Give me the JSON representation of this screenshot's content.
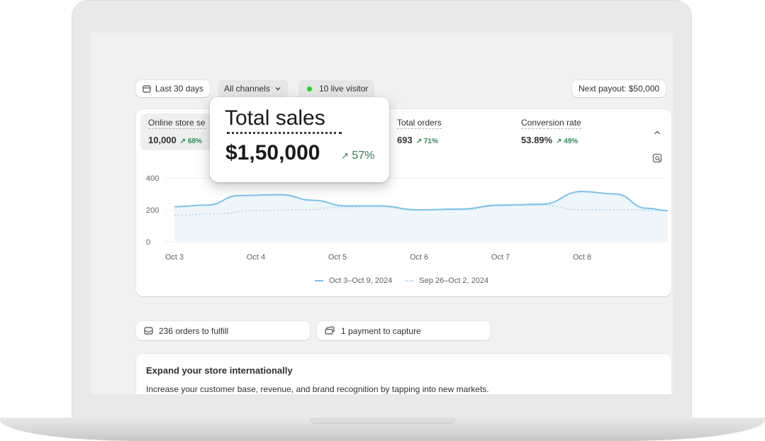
{
  "filters": {
    "date_range": "Last 30 days",
    "channels": "All channels",
    "live_visitors": "10 live visitor",
    "payout": "Next payout: $50,000"
  },
  "metrics": [
    {
      "label": "Online store se",
      "value": "10,000",
      "change": "68%"
    },
    {
      "label": "Total orders",
      "value": "693",
      "change": "71%"
    },
    {
      "label": "Conversion rate",
      "value": "53.89%",
      "change": "49%"
    }
  ],
  "tooltip": {
    "title": "Total sales",
    "value": "$1,50,000",
    "change": "57%"
  },
  "chart_data": {
    "type": "line",
    "x": [
      "Oct 3",
      "Oct 4",
      "Oct 5",
      "Oct 6",
      "Oct 7",
      "Oct 8"
    ],
    "y_ticks": [
      "400",
      "200",
      "0"
    ],
    "ylim": [
      0,
      400
    ],
    "series": [
      {
        "name": "Oct 3–Oct 9, 2024",
        "color": "#7cc0ea",
        "style": "solid",
        "points": [
          [
            0,
            220
          ],
          [
            0.4,
            230
          ],
          [
            0.8,
            290
          ],
          [
            1.3,
            295
          ],
          [
            1.7,
            260
          ],
          [
            2.1,
            225
          ],
          [
            2.5,
            225
          ],
          [
            3.0,
            200
          ],
          [
            3.5,
            205
          ],
          [
            4.0,
            230
          ],
          [
            4.5,
            235
          ],
          [
            5.0,
            315
          ],
          [
            5.4,
            300
          ],
          [
            5.8,
            210
          ],
          [
            6.05,
            195
          ]
        ]
      },
      {
        "name": "Sep 26–Oct 2, 2024",
        "color": "#bcd8ee",
        "style": "dotted",
        "points": [
          [
            0,
            165
          ],
          [
            0.5,
            175
          ],
          [
            1.0,
            195
          ],
          [
            1.6,
            200
          ],
          [
            2.0,
            215
          ],
          [
            2.5,
            220
          ],
          [
            3.0,
            200
          ],
          [
            3.5,
            200
          ],
          [
            4.0,
            225
          ],
          [
            4.5,
            230
          ],
          [
            5.0,
            200
          ],
          [
            5.5,
            200
          ],
          [
            6.05,
            195
          ]
        ]
      }
    ],
    "legend_position": "bottom-center",
    "grid": true
  },
  "actions": {
    "orders": "236 orders to fulfill",
    "payment": "1 payment to capture"
  },
  "banner": {
    "title": "Expand your store internationally",
    "text": "Increase your customer base, revenue, and brand recognition by tapping into new markets."
  },
  "icons": {
    "calendar": "calendar-icon",
    "chevron": "chevron-down-icon",
    "collapse": "chevron-up-icon",
    "orders": "inbox-icon",
    "payment": "cash-icon",
    "analytics": "analytics-icon",
    "trend": "arrow-up-right-icon"
  }
}
